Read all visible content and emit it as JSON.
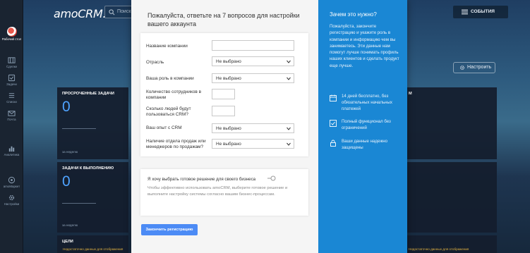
{
  "app": {
    "logo": "amoCRM."
  },
  "search": {
    "placeholder": "Поиск"
  },
  "header": {
    "events_label": "СОБЫТИЯ",
    "settings_label": "Настроить"
  },
  "sidebar": {
    "items": [
      {
        "label": "Рабочий стол",
        "icon": "dashboard-icon"
      },
      {
        "label": "Сделки",
        "icon": "deals-icon"
      },
      {
        "label": "Задачи",
        "icon": "tasks-icon"
      },
      {
        "label": "Списки",
        "icon": "lists-icon"
      },
      {
        "label": "Почта",
        "icon": "mail-icon"
      },
      {
        "label": "Аналитика",
        "icon": "analytics-icon"
      },
      {
        "label": "amoМаркет",
        "icon": "market-icon"
      },
      {
        "label": "Настройки",
        "icon": "settings-icon"
      }
    ]
  },
  "widgets": {
    "overdue": {
      "title": "ПРОСРОЧЕННЫЕ ЗАДАЧИ",
      "value": "0",
      "period": "за неделю"
    },
    "todo": {
      "title": "ЗАДАЧИ К ВЫПОЛНЕНИЮ",
      "value": "0",
      "period": "за неделю"
    },
    "goals": {
      "title": "ЦЕЛИ",
      "warning": "Недостаточно данных для отображения"
    },
    "right_goals": {
      "warning": "Недостаточно данных для отображения"
    },
    "right_title_fragment": "М"
  },
  "modal": {
    "heading": "Пожалуйста, ответьте на 7 вопросов для настройки вашего аккаунта",
    "fields": {
      "company": {
        "label": "Название компании",
        "value": ""
      },
      "industry": {
        "label": "Отрасль",
        "value": "Не выбрано"
      },
      "role": {
        "label": "Ваша роль в компании",
        "value": "Не выбрано"
      },
      "employees": {
        "label": "Количество сотрудников в компании",
        "value": ""
      },
      "crm_users": {
        "label": "Сколько людей будут пользоваться CRM?",
        "value": ""
      },
      "crm_experience": {
        "label": "Ваш опыт с CRM",
        "value": "Не выбрано"
      },
      "sales_dept": {
        "label": "Наличие отдела продаж или менеджеров по продажам?",
        "value": "Не выбрано"
      }
    },
    "ready_solution": {
      "question": "Я хочу выбрать готовое решение для своего бизнеса",
      "enabled": false,
      "description": "Чтобы эффективно использовать amoCRM, выберите готовое решение и выполните настройку системы согласно вашим бизнес-процессам."
    },
    "finish_label": "Закончить регистрацию",
    "why": {
      "title": "Зачем это нужно?",
      "text": "Пожалуйста, закончите регистрацию и укажите роль в компании и информацию чем вы занимаетесь. Эти данные нам помогут лучше понимать профиль наших клиентов и сделать продукт еще лучше.",
      "benefits": [
        {
          "icon": "calendar-icon",
          "text": "14 дней бесплатно, без обязательных начальных платежей"
        },
        {
          "icon": "check-icon",
          "text": "Полный функционал без ограничений"
        },
        {
          "icon": "lock-icon",
          "text": "Ваши данные надежно защищены"
        }
      ]
    }
  },
  "colors": {
    "accent": "#1a87d4",
    "button": "#4c8bf5",
    "widget_number": "#4fa3ff",
    "sidebar": "#1a2431"
  }
}
